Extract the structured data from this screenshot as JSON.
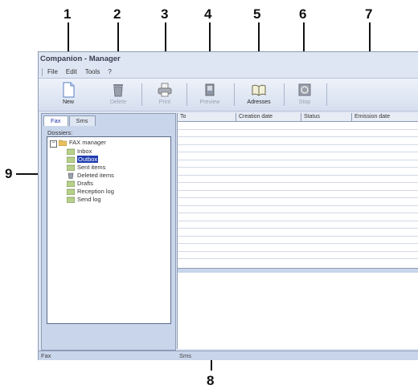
{
  "callouts": [
    "1",
    "2",
    "3",
    "4",
    "5",
    "6",
    "7",
    "8",
    "9"
  ],
  "window": {
    "title": "Companion - Manager",
    "menu": [
      "File",
      "Edit",
      "Tools",
      "?"
    ]
  },
  "toolbar": {
    "new": {
      "label": "New",
      "icon": "new-document-icon"
    },
    "delete": {
      "label": "Delete",
      "icon": "trash-icon"
    },
    "print": {
      "label": "Print",
      "icon": "printer-icon"
    },
    "preview": {
      "label": "Preview",
      "icon": "preview-icon"
    },
    "addresses": {
      "label": "Adresses",
      "icon": "address-book-icon"
    },
    "stop": {
      "label": "Stop",
      "icon": "stop-icon"
    }
  },
  "left_pane": {
    "tabs": [
      "Fax",
      "Sms"
    ],
    "folders_label": "Dossiers:",
    "tree": {
      "root": "FAX manager",
      "items": [
        "Inbox",
        "Outbox",
        "Sent items",
        "Deleted items",
        "Drafts",
        "Reception log",
        "Send log"
      ],
      "selected": "Outbox"
    }
  },
  "list": {
    "columns": [
      "To",
      "Creation date",
      "Status",
      "Emission date"
    ],
    "row_count": 18
  },
  "statusbar": {
    "left": "Fax",
    "right": "Sms"
  },
  "colors": {
    "window_bg": "#dfe6f3",
    "pane_bg": "#c9d5ea",
    "selection": "#1f3cb0"
  }
}
